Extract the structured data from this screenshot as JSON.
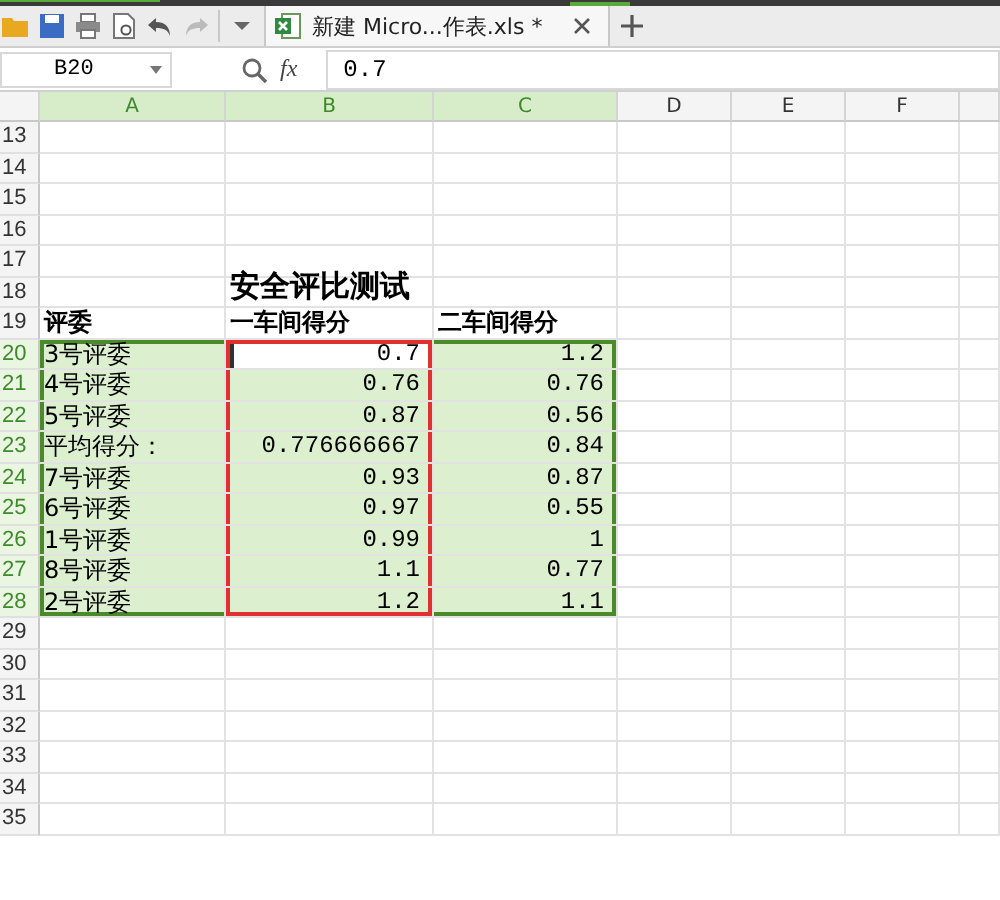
{
  "document_tab": {
    "title": "新建 Micro...作表.xls *"
  },
  "formula_bar": {
    "name_box": "B20",
    "fx": "fx",
    "value": "0.7"
  },
  "columns": [
    {
      "label": "A",
      "selected": true
    },
    {
      "label": "B",
      "selected": true
    },
    {
      "label": "C",
      "selected": true
    },
    {
      "label": "D",
      "selected": false
    },
    {
      "label": "E",
      "selected": false
    },
    {
      "label": "F",
      "selected": false
    }
  ],
  "rows": [
    {
      "number": "13",
      "kind": "blank",
      "selected": false
    },
    {
      "number": "14",
      "kind": "blank",
      "selected": false
    },
    {
      "number": "15",
      "kind": "blank",
      "selected": false
    },
    {
      "number": "16",
      "kind": "blank",
      "selected": false
    },
    {
      "number": "17",
      "kind": "blank",
      "selected": false
    },
    {
      "number": "18",
      "kind": "title",
      "selected": false,
      "title": "安全评比测试"
    },
    {
      "number": "19",
      "kind": "header",
      "selected": false,
      "cells": [
        "评委",
        "一车间得分",
        "二车间得分"
      ]
    },
    {
      "number": "20",
      "kind": "data",
      "selected": true,
      "cells": [
        {
          "text": "3号评委",
          "active": false
        },
        {
          "text": "0.7",
          "active": true
        },
        {
          "text": "1.2",
          "active": false
        }
      ]
    },
    {
      "number": "21",
      "kind": "data",
      "selected": true,
      "cells": [
        {
          "text": "4号评委",
          "active": false
        },
        {
          "text": "0.76",
          "active": false
        },
        {
          "text": "0.76",
          "active": false
        }
      ]
    },
    {
      "number": "22",
      "kind": "data",
      "selected": true,
      "cells": [
        {
          "text": "5号评委",
          "active": false
        },
        {
          "text": "0.87",
          "active": false
        },
        {
          "text": "0.56",
          "active": false
        }
      ]
    },
    {
      "number": "23",
      "kind": "data",
      "selected": true,
      "cells": [
        {
          "text": "平均得分：",
          "active": false
        },
        {
          "text": "0.776666667",
          "active": false
        },
        {
          "text": "0.84",
          "active": false
        }
      ]
    },
    {
      "number": "24",
      "kind": "data",
      "selected": true,
      "cells": [
        {
          "text": "7号评委",
          "active": false
        },
        {
          "text": "0.93",
          "active": false
        },
        {
          "text": "0.87",
          "active": false
        }
      ]
    },
    {
      "number": "25",
      "kind": "data",
      "selected": true,
      "cells": [
        {
          "text": "6号评委",
          "active": false
        },
        {
          "text": "0.97",
          "active": false
        },
        {
          "text": "0.55",
          "active": false
        }
      ]
    },
    {
      "number": "26",
      "kind": "data",
      "selected": true,
      "cells": [
        {
          "text": "1号评委",
          "active": false
        },
        {
          "text": "0.99",
          "active": false
        },
        {
          "text": "1",
          "active": false
        }
      ]
    },
    {
      "number": "27",
      "kind": "data",
      "selected": true,
      "cells": [
        {
          "text": "8号评委",
          "active": false
        },
        {
          "text": "1.1",
          "active": false
        },
        {
          "text": "0.77",
          "active": false
        }
      ]
    },
    {
      "number": "28",
      "kind": "data",
      "selected": true,
      "cells": [
        {
          "text": "2号评委",
          "active": false
        },
        {
          "text": "1.2",
          "active": false
        },
        {
          "text": "1.1",
          "active": false
        }
      ]
    },
    {
      "number": "29",
      "kind": "blank",
      "selected": false
    },
    {
      "number": "30",
      "kind": "blank",
      "selected": false
    },
    {
      "number": "31",
      "kind": "blank",
      "selected": false
    },
    {
      "number": "32",
      "kind": "blank",
      "selected": false
    },
    {
      "number": "33",
      "kind": "blank",
      "selected": false
    },
    {
      "number": "34",
      "kind": "blank",
      "selected": false
    },
    {
      "number": "35",
      "kind": "blank",
      "selected": false
    }
  ]
}
